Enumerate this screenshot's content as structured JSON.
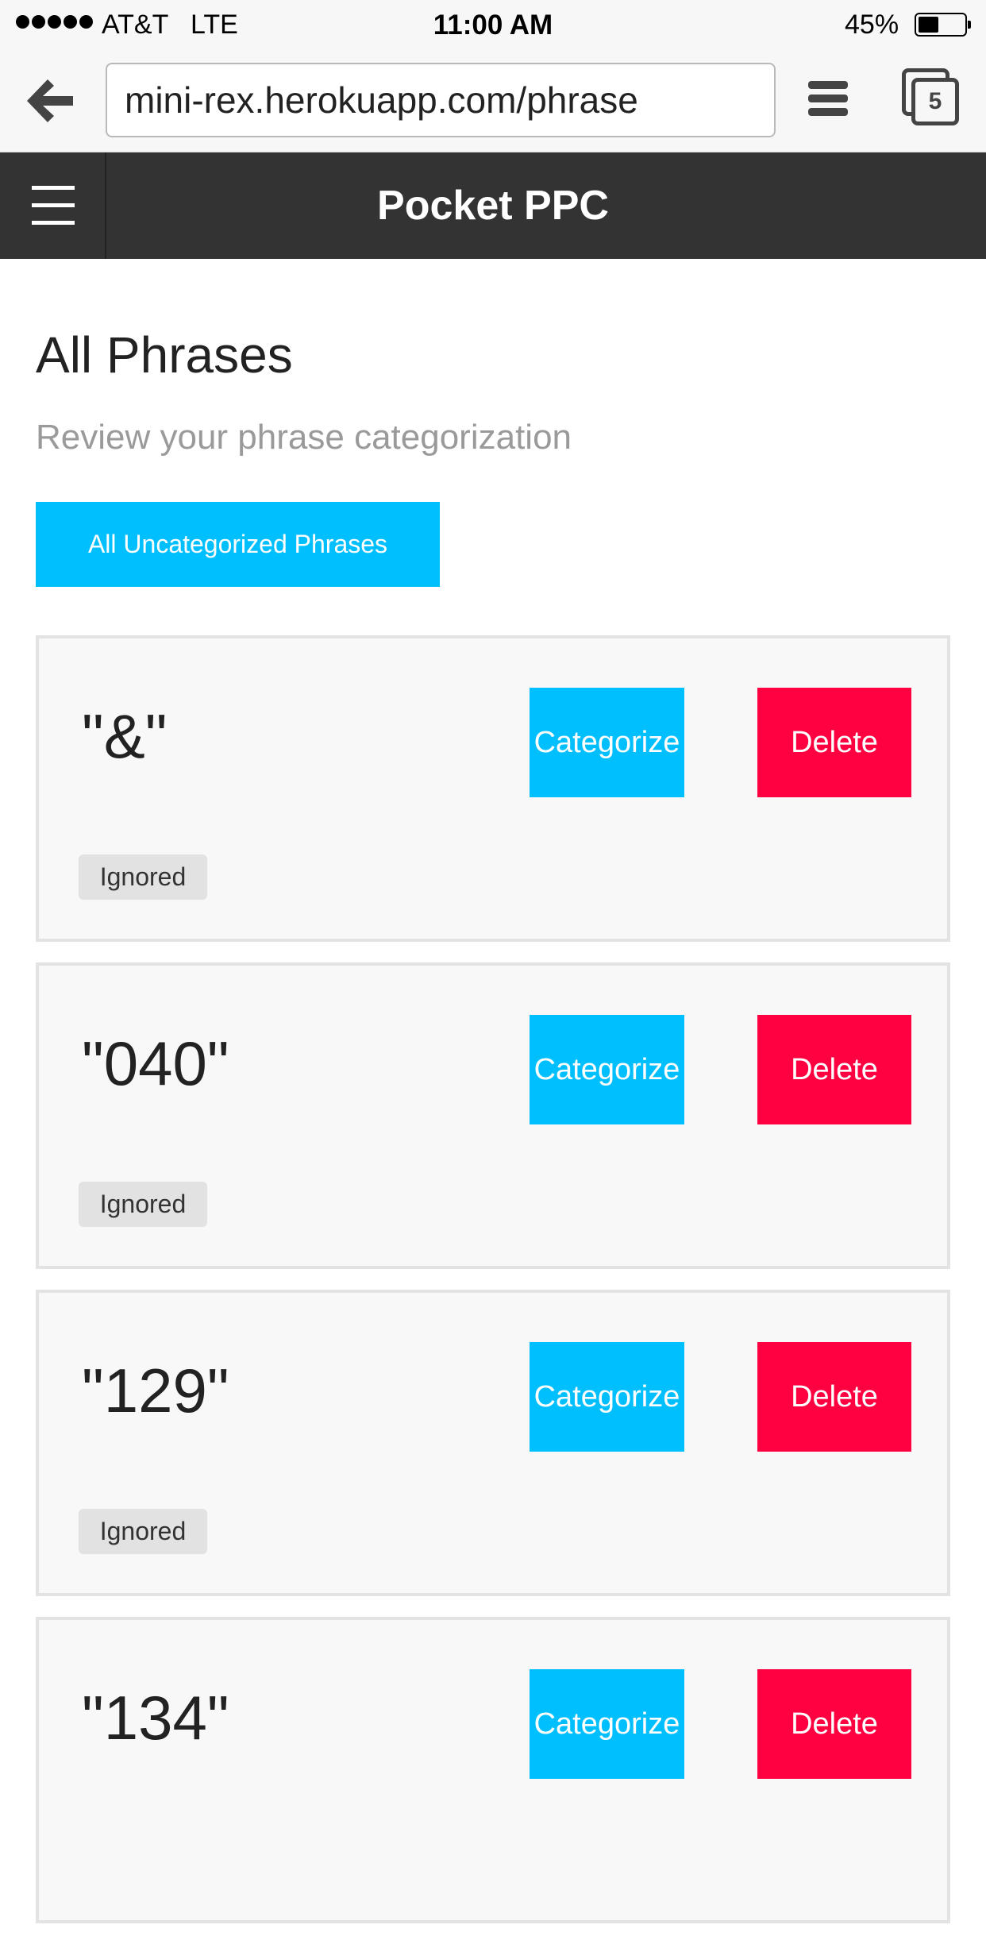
{
  "status_bar": {
    "carrier": "AT&T",
    "network": "LTE",
    "time": "11:00 AM",
    "battery_percent": "45%",
    "battery_level": 0.45
  },
  "browser": {
    "url": "mini-rex.herokuapp.com/phrase",
    "tab_count": "5",
    "icons": {
      "back": "back-arrow-icon",
      "menu": "menu-icon",
      "tabs": "tabs-icon"
    }
  },
  "app": {
    "title": "Pocket PPC",
    "menu_icon": "hamburger-icon"
  },
  "page": {
    "title": "All Phrases",
    "subtitle": "Review your phrase categorization",
    "primary_button": "All Uncategorized Phrases"
  },
  "phrases": [
    {
      "text": "\"&\"",
      "categorize": "Categorize",
      "delete": "Delete",
      "status": "Ignored"
    },
    {
      "text": "\"040\"",
      "categorize": "Categorize",
      "delete": "Delete",
      "status": "Ignored"
    },
    {
      "text": "\"129\"",
      "categorize": "Categorize",
      "delete": "Delete",
      "status": "Ignored"
    },
    {
      "text": "\"134\"",
      "categorize": "Categorize",
      "delete": "Delete",
      "status": ""
    }
  ],
  "colors": {
    "accent_blue": "#00bfff",
    "delete_red": "#ff0040",
    "header_dark": "#333333"
  }
}
